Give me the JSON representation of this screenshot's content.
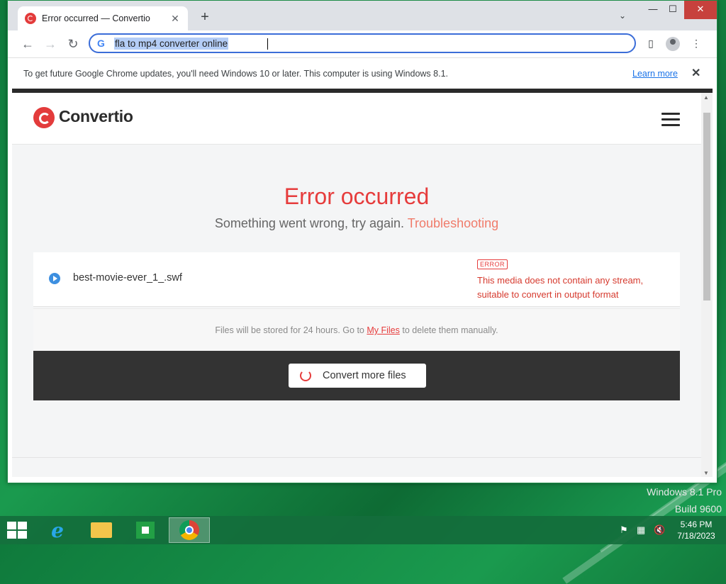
{
  "browser": {
    "tab_title": "Error occurred — Convertio",
    "address": "fla to mp4 converter online",
    "infobar_text": "To get future Google Chrome updates, you'll need Windows 10 or later. This computer is using Windows 8.1.",
    "infobar_link": "Learn more"
  },
  "site": {
    "logo_text": "Convertio",
    "error_title": "Error occurred",
    "error_subtitle": "Something went wrong, try again.",
    "troubleshooting_link": "Troubleshooting",
    "file": {
      "name": "best-movie-ever_1_.swf",
      "badge": "ERROR",
      "message": "This media does not contain any stream, suitable to convert in output format"
    },
    "note_before": "Files will be stored for 24 hours. Go to",
    "note_link": "My Files",
    "note_after": "to delete them manually.",
    "convert_more": "Convert more files"
  },
  "desktop": {
    "watermark_line1": "Windows 8.1 Pro",
    "watermark_line2": "Build 9600"
  },
  "taskbar": {
    "apps": [
      "internet-explorer",
      "file-explorer",
      "store",
      "chrome"
    ],
    "time": "5:46 PM",
    "date": "7/18/2023"
  },
  "colors": {
    "accent_red": "#e63c3c",
    "link_blue": "#1a73e8",
    "desktop_green": "#1a9a4e"
  }
}
